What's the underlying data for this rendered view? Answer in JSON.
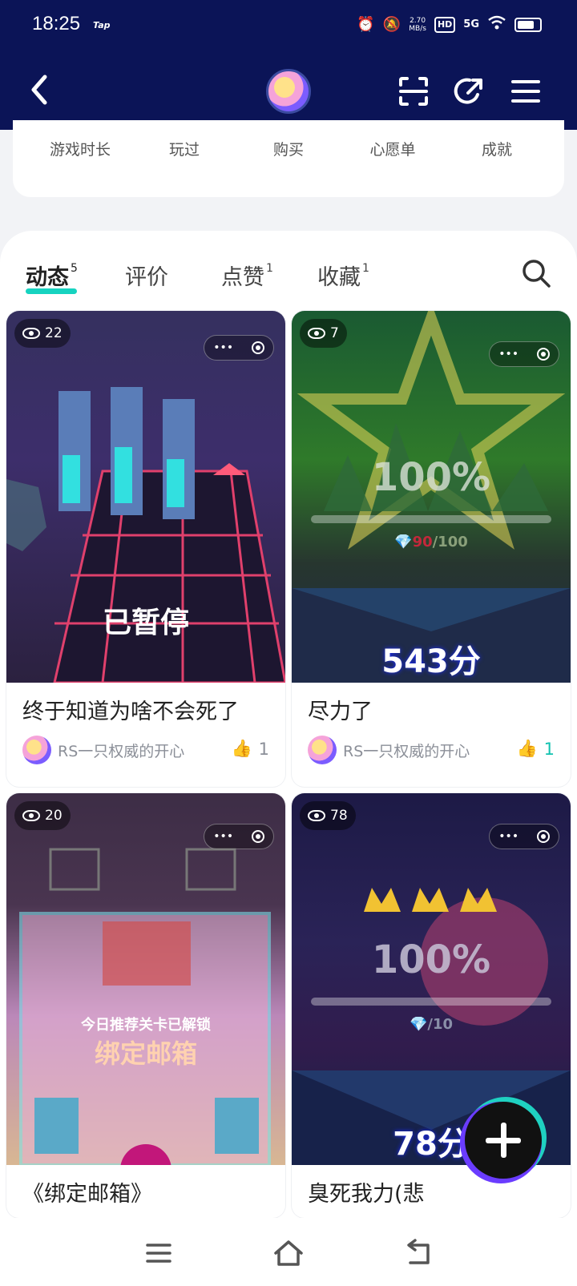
{
  "status": {
    "time": "18:25",
    "carrier_tag": "Tap",
    "speed": "2.70\nMB/s",
    "hd": "HD",
    "signal": "5G"
  },
  "header": {
    "back": "back",
    "icons": [
      "scan-icon",
      "share-icon",
      "menu-icon"
    ]
  },
  "stats": {
    "labels": [
      "游戏时长",
      "玩过",
      "购买",
      "心愿单",
      "成就"
    ]
  },
  "tabs": [
    {
      "label": "动态",
      "count": "5"
    },
    {
      "label": "评价",
      "count": ""
    },
    {
      "label": "点赞",
      "count": "1"
    },
    {
      "label": "收藏",
      "count": "1"
    }
  ],
  "posts": [
    {
      "views": "22",
      "overlay": "已暂停",
      "title": "终于知道为啥不会死了",
      "author": "RS一只权威的开心",
      "likes": "1",
      "liked": false
    },
    {
      "views": "7",
      "percent": "100%",
      "gems": "90",
      "gems_total": "/100",
      "score": "543分",
      "title": "尽力了",
      "author": "RS一只权威的开心",
      "likes": "1",
      "liked": true
    },
    {
      "views": "20",
      "banner_sub": "今日推荐关卡已解锁",
      "banner_main": "绑定邮箱",
      "title": "《绑定邮箱》"
    },
    {
      "views": "78",
      "percent": "100%",
      "gems_total": "/10",
      "score": "78分",
      "title": "臭死我力(悲"
    }
  ]
}
